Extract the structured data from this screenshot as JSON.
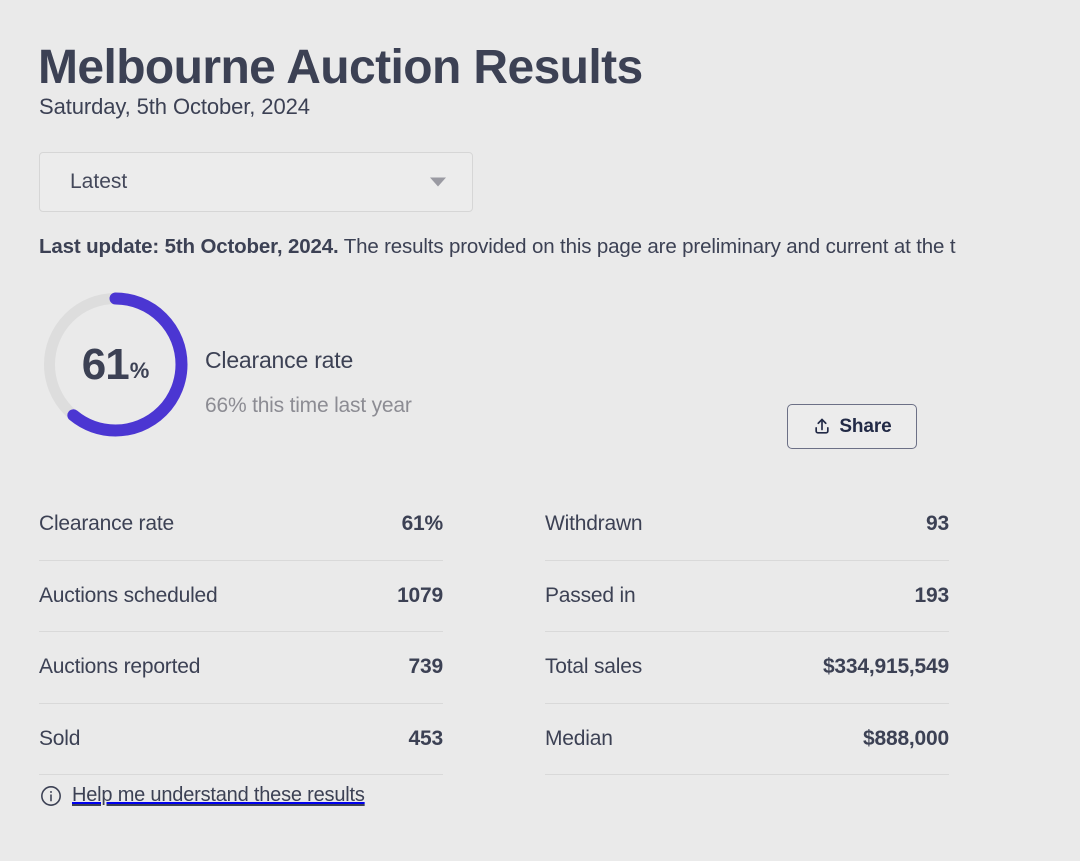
{
  "header": {
    "title": "Melbourne Auction Results",
    "subtitle": "Saturday, 5th October, 2024"
  },
  "period_select": {
    "selected": "Latest",
    "options": [
      "Latest"
    ],
    "icon": "chevron-down-icon"
  },
  "last_update": {
    "bold_prefix": "Last update: 5th October, 2024.",
    "rest": " The results provided on this page are preliminary and current at the t"
  },
  "clearance": {
    "donut_value": "61",
    "donut_unit": "%",
    "title": "Clearance rate",
    "subtitle": "66% this time last year",
    "arc_percent": 61,
    "arc_color": "#4b36d2",
    "track_color": "#dddddd"
  },
  "share": {
    "label": "Share",
    "icon": "share-upload-icon"
  },
  "stats": {
    "left": [
      {
        "label": "Clearance rate",
        "value": "61%"
      },
      {
        "label": "Auctions scheduled",
        "value": "1079"
      },
      {
        "label": "Auctions reported",
        "value": "739"
      },
      {
        "label": "Sold",
        "value": "453"
      }
    ],
    "right": [
      {
        "label": "Withdrawn",
        "value": "93"
      },
      {
        "label": "Passed in",
        "value": "193"
      },
      {
        "label": "Total sales",
        "value": "$334,915,549"
      },
      {
        "label": "Median",
        "value": "$888,000"
      }
    ]
  },
  "help": {
    "label": "Help me understand these results",
    "icon": "info-circle-icon"
  },
  "colors": {
    "background": "#eaeaea",
    "text": "#3c4154",
    "muted": "#8c8c93",
    "accent": "#4b36d2",
    "divider": "#d9d9d9"
  }
}
